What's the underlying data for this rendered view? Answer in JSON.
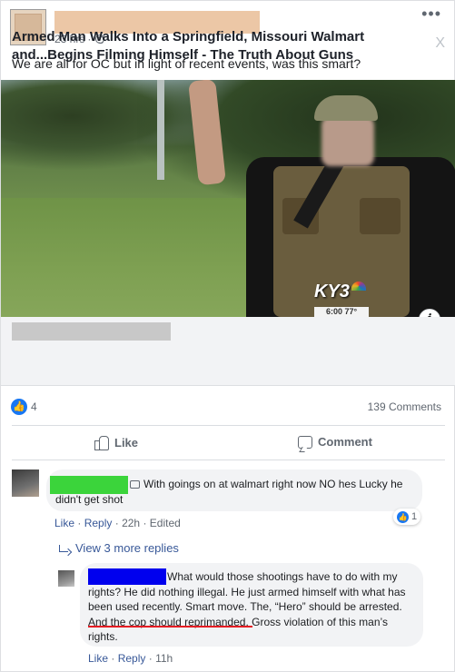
{
  "post": {
    "time": "23 hrs",
    "text": "We are all for OC but in light of recent events, was this smart?",
    "menu_icon": "more-icon",
    "close_label": "X"
  },
  "image": {
    "station_logo": "KY3",
    "tv_time": "6:00  77°",
    "info_label": "i"
  },
  "link": {
    "title": "Armed Man Walks Into a Springfield, Missouri Walmart and...Begins Filming Himself - The Truth About Guns"
  },
  "stats": {
    "likes": "4",
    "comments": "139 Comments"
  },
  "actions": {
    "like": "Like",
    "comment": "Comment"
  },
  "comments": [
    {
      "text": "With goings on at walmart right now NO hes Lucky he didn't get shot",
      "reaction_count": "1",
      "like": "Like",
      "reply": "Reply",
      "time": "22h",
      "edited": "Edited",
      "view_replies": "View 3 more replies"
    },
    {
      "text": "What would those shootings have to do with my rights? He did nothing illegal. He just armed himself with what has been used recently. Smart move. The, “Hero” should be arrested. And the cop should reprimanded. Gross violation of this man’s rights.",
      "like": "Like",
      "reply": "Reply",
      "time": "11h"
    }
  ],
  "colors": {
    "facebook_blue": "#1877f2",
    "link_blue": "#385898",
    "redact_green": "#3bd43b",
    "redact_blue": "#0000ee",
    "underline_red": "#e51c23"
  }
}
